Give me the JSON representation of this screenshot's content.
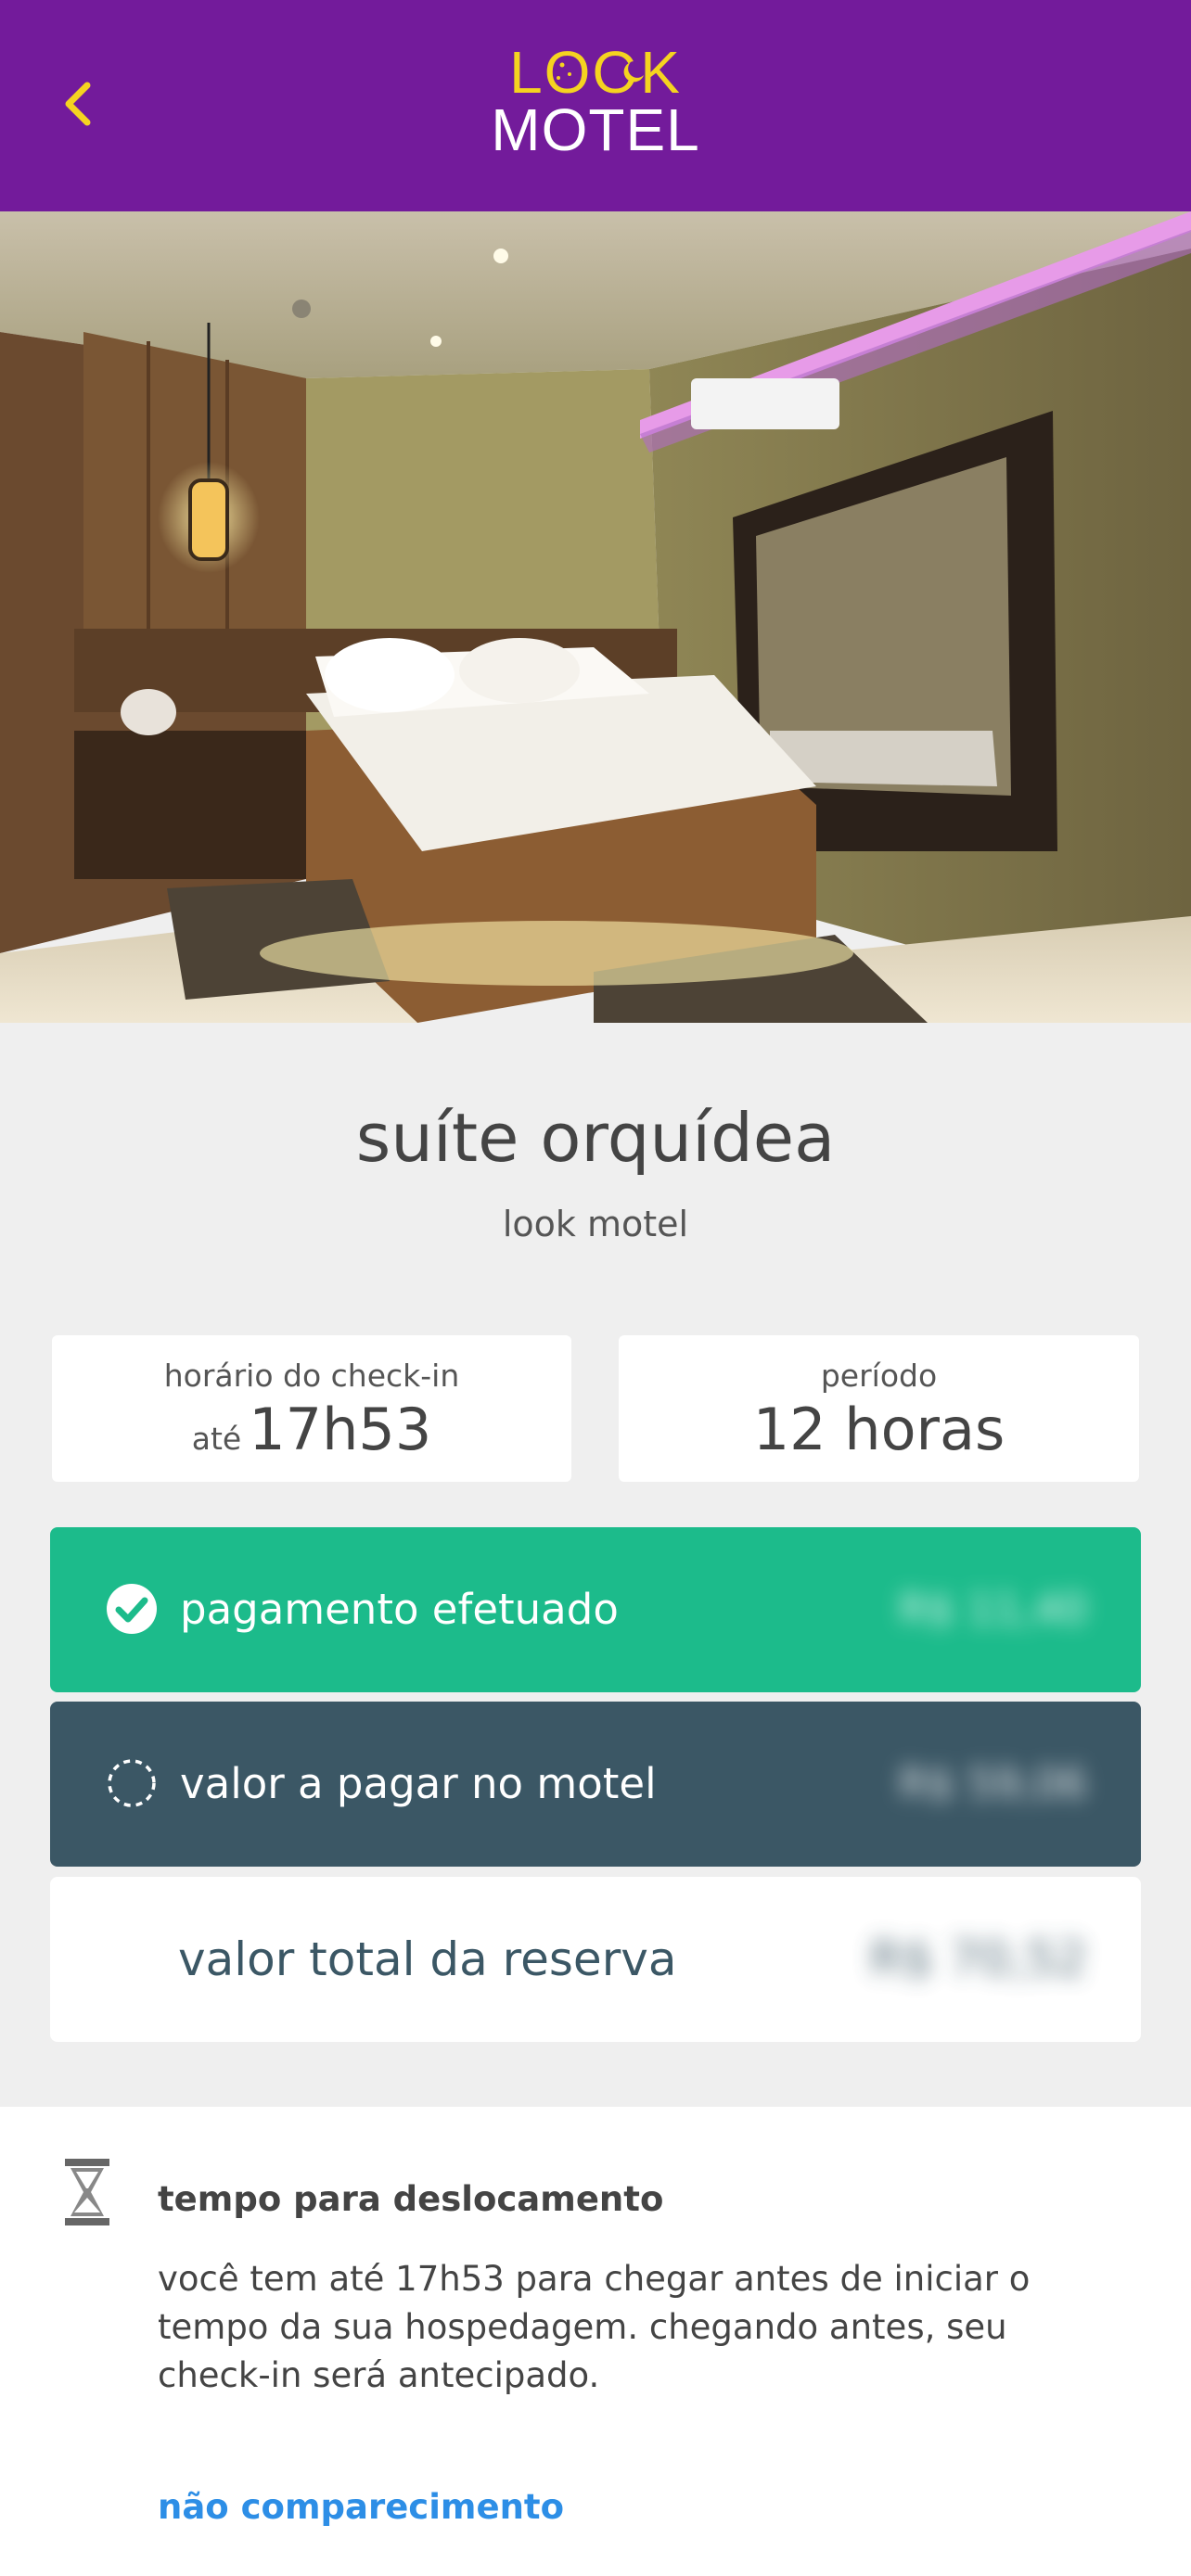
{
  "header": {
    "logo_line1": "LOOK",
    "logo_line2": "MOTEL",
    "back_icon": "chevron-left-icon",
    "bg_color": "#731b9b",
    "accent_color": "#f5d320"
  },
  "photo": {
    "subject": "suite bedroom photo"
  },
  "suite": {
    "name": "suíte orquídea",
    "motel": "look motel"
  },
  "checkin": {
    "label": "horário do check-in",
    "prefix": "até",
    "time": "17h53"
  },
  "period": {
    "label": "período",
    "value": "12 horas"
  },
  "payment_paid": {
    "label": "pagamento efetuado",
    "amount": "R$ 11,40",
    "icon": "check-circle-icon",
    "color": "#1cbb8b"
  },
  "payment_due": {
    "label": "valor a pagar no motel",
    "amount": "R$ 59,06",
    "icon": "dashed-circle-icon",
    "color": "#3b5765"
  },
  "payment_total": {
    "label": "valor total da reserva",
    "amount": "R$ 70,52"
  },
  "notice": {
    "icon": "hourglass-icon",
    "title": "tempo para deslocamento",
    "body": "você tem até 17h53 para chegar antes de iniciar o tempo da sua hospedagem. chegando antes, seu check-in será antecipado.",
    "link": "não comparecimento",
    "link_color": "#2d8ee6"
  }
}
